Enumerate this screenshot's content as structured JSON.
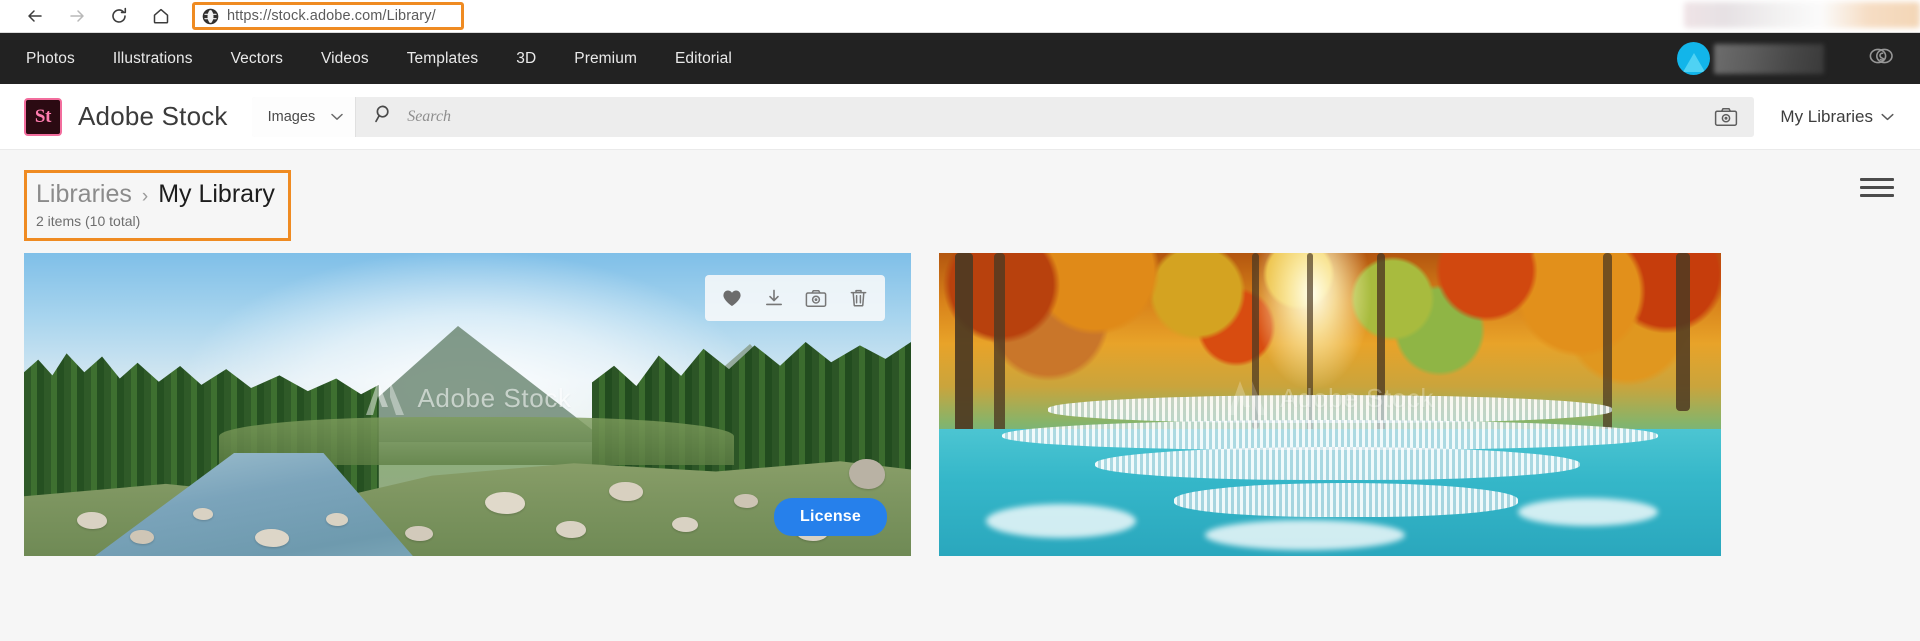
{
  "browser": {
    "back_label": "Back",
    "forward_label": "Forward",
    "reload_label": "Reload",
    "home_label": "Home",
    "url": "https://stock.adobe.com/Library/",
    "url_scheme": "https://",
    "url_host": "stock.adobe.com",
    "url_path": "/Library/",
    "site_icon": "globe-icon",
    "profile_area": "redacted-profile-region"
  },
  "global_nav": {
    "items": [
      {
        "label": "Photos"
      },
      {
        "label": "Illustrations"
      },
      {
        "label": "Vectors"
      },
      {
        "label": "Videos"
      },
      {
        "label": "Templates"
      },
      {
        "label": "3D"
      },
      {
        "label": "Premium"
      },
      {
        "label": "Editorial"
      }
    ],
    "avatar_color": "#12b5ea",
    "username": "",
    "cc_icon": "creative-cloud-icon",
    "background": "#222222"
  },
  "stock_header": {
    "logo_initials": "St",
    "logo_text": "Adobe Stock",
    "logo_bg": "#2b0a12",
    "logo_accent": "#f26d9d",
    "category": "Images",
    "search_placeholder": "Search",
    "search_value": "",
    "visual_search_icon": "camera-icon",
    "my_libraries_label": "My Libraries",
    "chevron": "⌄"
  },
  "breadcrumb": {
    "root": "Libraries",
    "separator": "›",
    "current": "My Library",
    "count_text": "2 items (10 total)",
    "highlight_color": "#ef8b22"
  },
  "toolbar": {
    "menu_icon": "hamburger-menu-icon"
  },
  "asset_actions": {
    "favorite": "heart-icon",
    "download": "download-icon",
    "find_similar": "camera-icon",
    "delete": "trash-icon",
    "license_label": "License",
    "license_color": "#2680eb"
  },
  "watermark": {
    "text": "Adobe Stock",
    "mark": "adobe-a-icon"
  },
  "assets": [
    {
      "name": "mountain-river-landscape",
      "alt": "Mountain river valley with pine forest and fog",
      "has_hover_toolbar": true,
      "has_license_button": true,
      "has_watermark": true
    },
    {
      "name": "autumn-waterfall",
      "alt": "Autumn forest waterfall with turquoise pools",
      "has_hover_toolbar": false,
      "has_license_button": false,
      "has_watermark": true
    }
  ]
}
